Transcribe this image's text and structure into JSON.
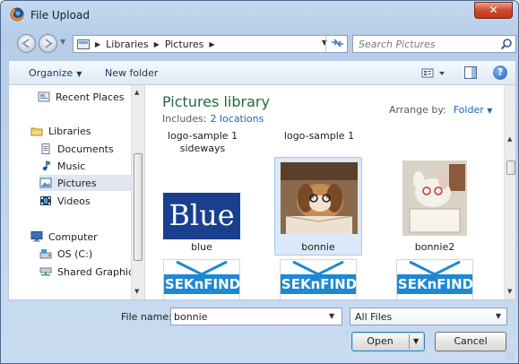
{
  "window": {
    "title": "File Upload",
    "close_symbol": "✕"
  },
  "address": {
    "crumbs": [
      "Libraries",
      "Pictures"
    ],
    "search_placeholder": "Search Pictures"
  },
  "toolbar": {
    "organize": "Organize",
    "new_folder": "New folder",
    "help": "?"
  },
  "nav": {
    "items": [
      {
        "label": "Recent Places",
        "icon": "recent-places-icon"
      },
      {
        "label": "Libraries",
        "icon": "libraries-icon"
      },
      {
        "label": "Documents",
        "icon": "documents-icon"
      },
      {
        "label": "Music",
        "icon": "music-icon"
      },
      {
        "label": "Pictures",
        "icon": "pictures-icon",
        "selected": true
      },
      {
        "label": "Videos",
        "icon": "videos-icon"
      },
      {
        "label": "Computer",
        "icon": "computer-icon"
      },
      {
        "label": "OS (C:)",
        "icon": "drive-icon"
      },
      {
        "label": "Shared Graphics",
        "icon": "network-drive-icon"
      }
    ]
  },
  "library": {
    "title": "Pictures library",
    "includes_label": "Includes:",
    "includes_link": "2 locations",
    "arrange_label": "Arrange by:",
    "arrange_value": "Folder"
  },
  "files": [
    {
      "name": "logo-sample 1 sideways",
      "partial": true
    },
    {
      "name": "logo-sample 1",
      "partial": true
    },
    {
      "name": "blue",
      "thumb_text": "Blue"
    },
    {
      "name": "bonnie",
      "selected": true
    },
    {
      "name": "bonnie2"
    },
    {
      "name": "",
      "thumb_text": "SEKnFIND"
    },
    {
      "name": "",
      "thumb_text": "SEKnFIND"
    },
    {
      "name": "",
      "thumb_text": "SEKnFIND"
    }
  ],
  "bottom": {
    "file_name_label": "File name:",
    "file_name_value": "bonnie",
    "file_type": "All Files",
    "open_label": "Open",
    "cancel_label": "Cancel"
  },
  "colors": {
    "library_title": "#1e6c3a",
    "link": "#1565c0",
    "selection": "#dbe8f8",
    "blue_tile": "#1a3f8f",
    "seknfind": "#1e88d2"
  }
}
